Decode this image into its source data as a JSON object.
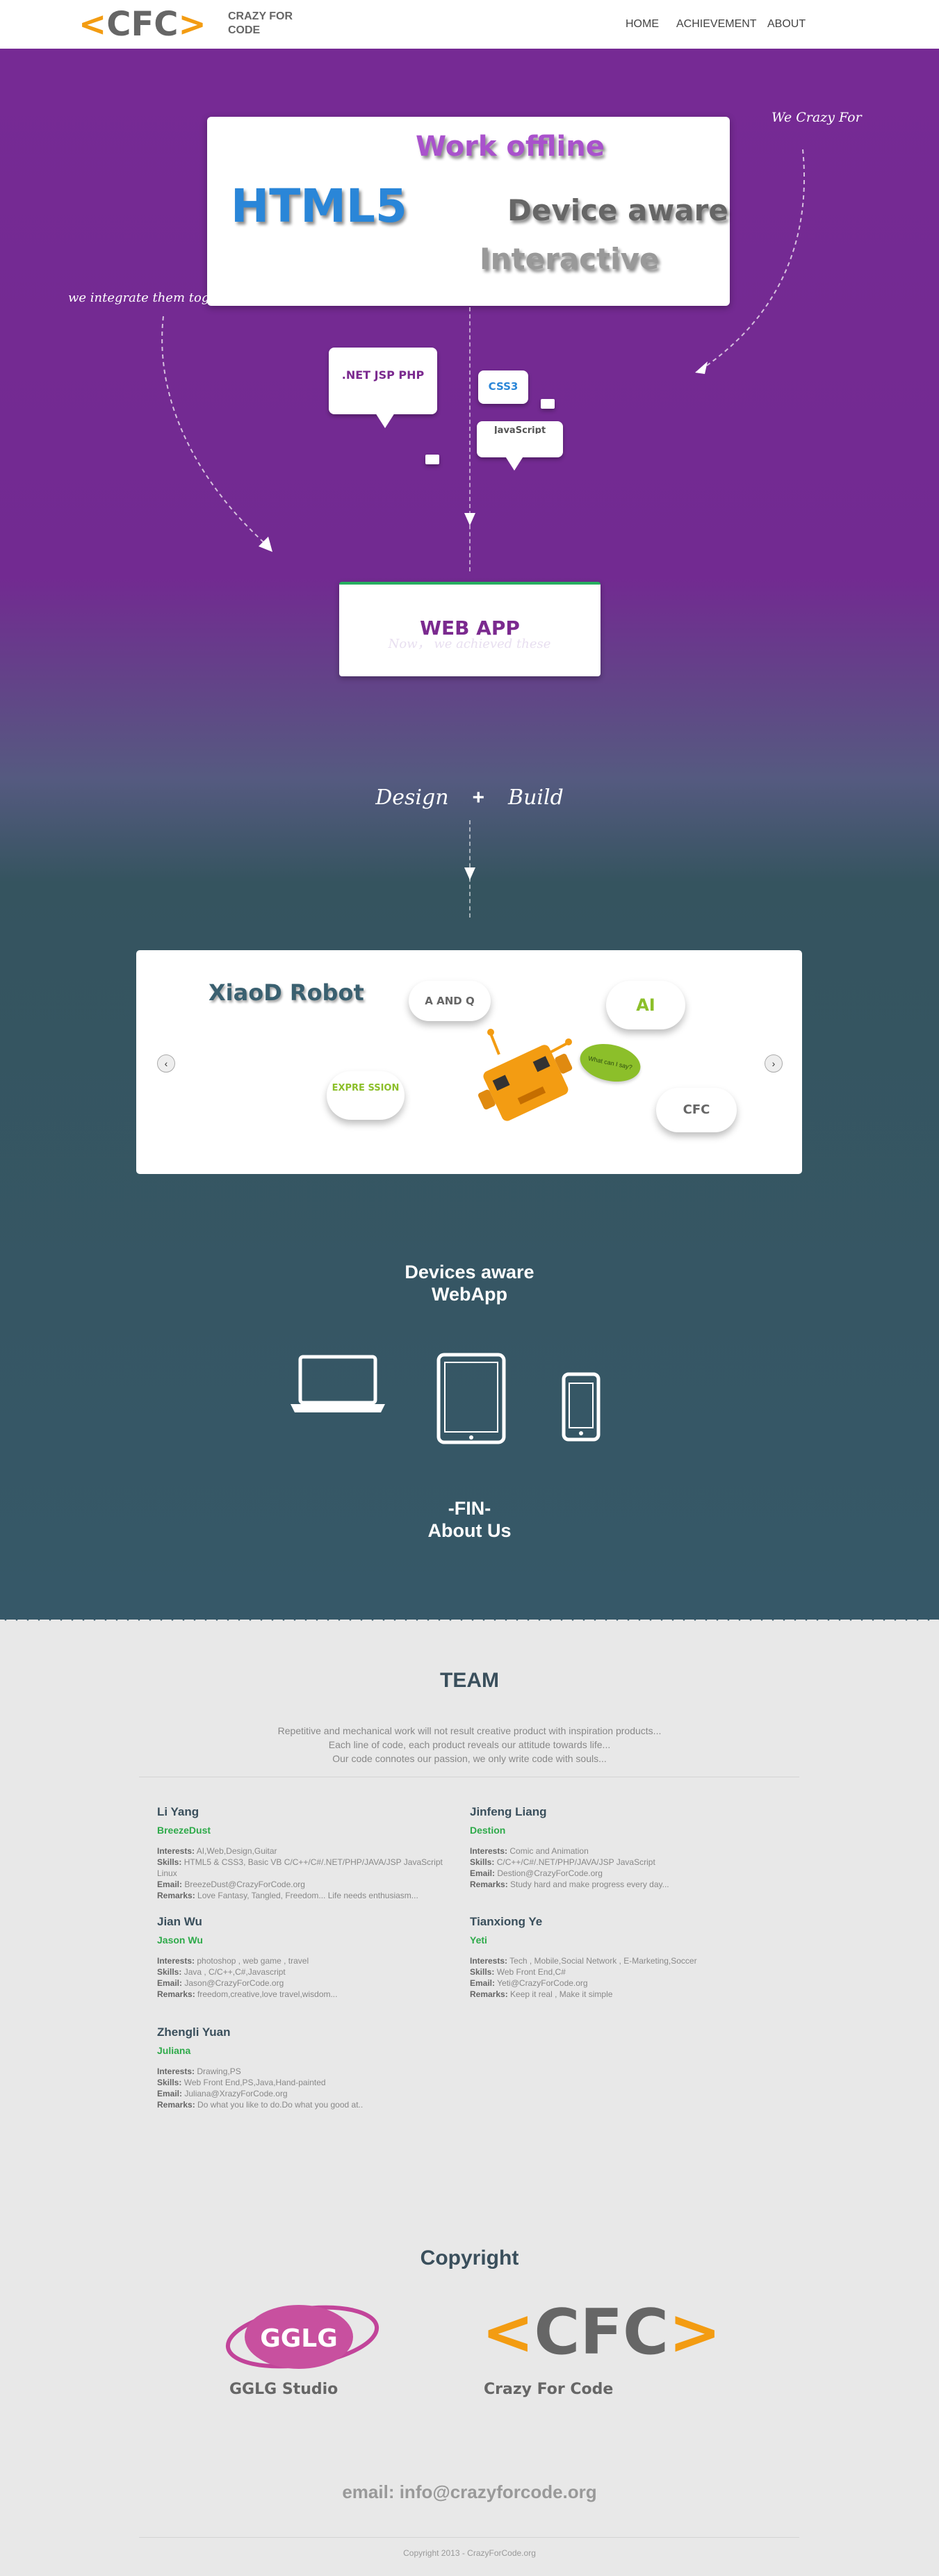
{
  "nav": {
    "logo_left": "<",
    "logo_mid": "CFC",
    "logo_right": ">",
    "logo_line1": "CRAZY FOR",
    "logo_line2": "CODE",
    "items": [
      {
        "label": "HOME"
      },
      {
        "label": "ACHIEVEMENT"
      },
      {
        "label": "ABOUT"
      }
    ]
  },
  "hero": {
    "tag_crazy": "We Crazy For",
    "tag_integrate": "we integrate them together",
    "words": {
      "offline": "Work offline",
      "html5": "HTML5",
      "device": "Device aware",
      "interactive": "Interactive"
    },
    "bubbles": {
      "tech": ".NET JSP PHP",
      "css": "CSS3",
      "js": "JavaScript"
    },
    "webapp": "WEB APP",
    "now": "Now，  we achieved these",
    "design": "Design",
    "plus": "+",
    "build": "Build",
    "colors": {
      "purple": "#762a94",
      "teal": "#365868",
      "green": "#27ae60",
      "orange": "#f39c12"
    }
  },
  "carousel": {
    "title": "XiaoD Robot",
    "clouds": {
      "aq": "A AND Q",
      "ai": "AI",
      "expression": "EXPRE SSION",
      "cfc": "CFC",
      "speech": "What can I say?"
    },
    "prev_icon": "chevron-left-icon",
    "next_icon": "chevron-right-icon"
  },
  "devices": {
    "heading1": "Devices aware",
    "heading2": "WebApp",
    "icons": [
      "laptop-icon",
      "tablet-icon",
      "phone-icon"
    ]
  },
  "fin": {
    "line1": "-FIN-",
    "line2": "About Us"
  },
  "team": {
    "title": "TEAM",
    "intro": [
      "Repetitive and mechanical work will not result creative product with inspiration products...",
      "Each line of code, each product reveals our attitude towards life...",
      "Our code connotes our passion, we only write code with souls..."
    ],
    "labels": {
      "interests": "Interests:",
      "skills": "Skills:",
      "email": "Email:",
      "remarks": "Remarks:"
    },
    "members": [
      {
        "name": "Li Yang",
        "nick": "BreezeDust",
        "interests": "AI,Web,Design,Guitar",
        "skills": "HTML5 & CSS3, Basic VB C/C++/C#/.NET/PHP/JAVA/JSP JavaScript Linux",
        "email": "BreezeDust@CrazyForCode.org",
        "remarks": "Love Fantasy, Tangled, Freedom... Life needs enthusiasm..."
      },
      {
        "name": "Jinfeng Liang",
        "nick": "Destion",
        "interests": "Comic and Animation",
        "skills": "C/C++/C#/.NET/PHP/JAVA/JSP JavaScript",
        "email": "Destion@CrazyForCode.org",
        "remarks": "Study hard and make progress every day..."
      },
      {
        "name": "Jian Wu",
        "nick": "Jason Wu",
        "interests": "photoshop , web game , travel",
        "skills": "Java , C/C++,C#,Javascript",
        "email": "Jason@CrazyForCode.org",
        "remarks": "freedom,creative,love travel,wisdom..."
      },
      {
        "name": "Tianxiong Ye",
        "nick": "Yeti",
        "interests": "Tech , Mobile,Social Network , E-Marketing,Soccer",
        "skills": "Web Front End,C#",
        "email": "Yeti@CrazyForCode.org",
        "remarks": "Keep it real , Make it simple"
      },
      {
        "name": "Zhengli Yuan",
        "nick": "Juliana",
        "interests": "Drawing,PS",
        "skills": "Web Front End,PS,Java,Hand-painted",
        "email": "Juliana@XrazyForCode.org",
        "remarks": "Do what you like to do.Do what you good at.."
      }
    ]
  },
  "copyright": {
    "title": "Copyright",
    "gglg_logo": "GGLG",
    "gglg_name": "GGLG Studio",
    "cfc_name": "Crazy For Code"
  },
  "email": "email: info@crazyforcode.org",
  "footer": "Copyright 2013 - CrazyForCode.org"
}
